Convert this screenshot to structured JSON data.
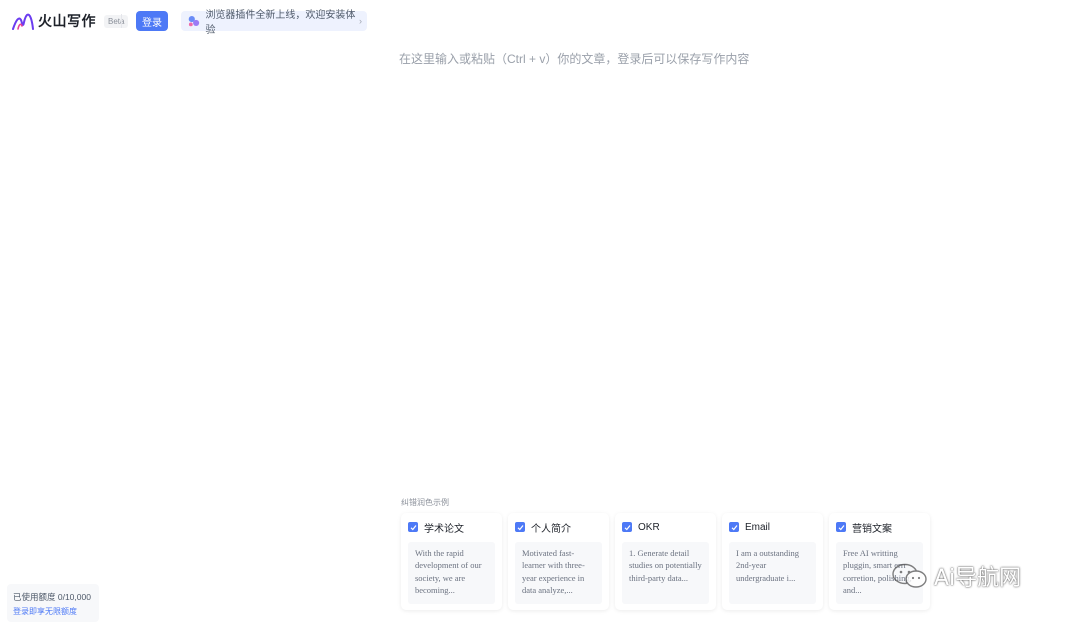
{
  "header": {
    "logo_text": "火山写作",
    "beta": "Beta",
    "login_label": "登录",
    "promo_text": "浏览器插件全新上线，欢迎安装体验",
    "promo_arrow": "›"
  },
  "editor": {
    "placeholder": "在这里输入或粘贴（Ctrl + v）你的文章，登录后可以保存写作内容"
  },
  "examples": {
    "label": "纠错润色示例",
    "cards": [
      {
        "title": "学术论文",
        "text": "With the rapid development of our society, we are becoming..."
      },
      {
        "title": "个人简介",
        "text": "Motivated fast-learner with three-year experience in data analyze,..."
      },
      {
        "title": "OKR",
        "text": "1. Generate detail studies on potentially third-party data..."
      },
      {
        "title": "Email",
        "text": "I am a outstanding 2nd-year undergraduate i..."
      },
      {
        "title": "营销文案",
        "text": "Free AI writting pluggin, smart errr corretion, polishing, and..."
      }
    ]
  },
  "usage": {
    "quota_text": "已使用额度 0/10,000",
    "login_hint": "登录即享无限额度"
  },
  "watermark": {
    "text": "Ai导航网"
  },
  "colors": {
    "accent": "#4d79f6",
    "promo_bg": "#eef2fe",
    "panel_bg": "#f7f8fa"
  }
}
